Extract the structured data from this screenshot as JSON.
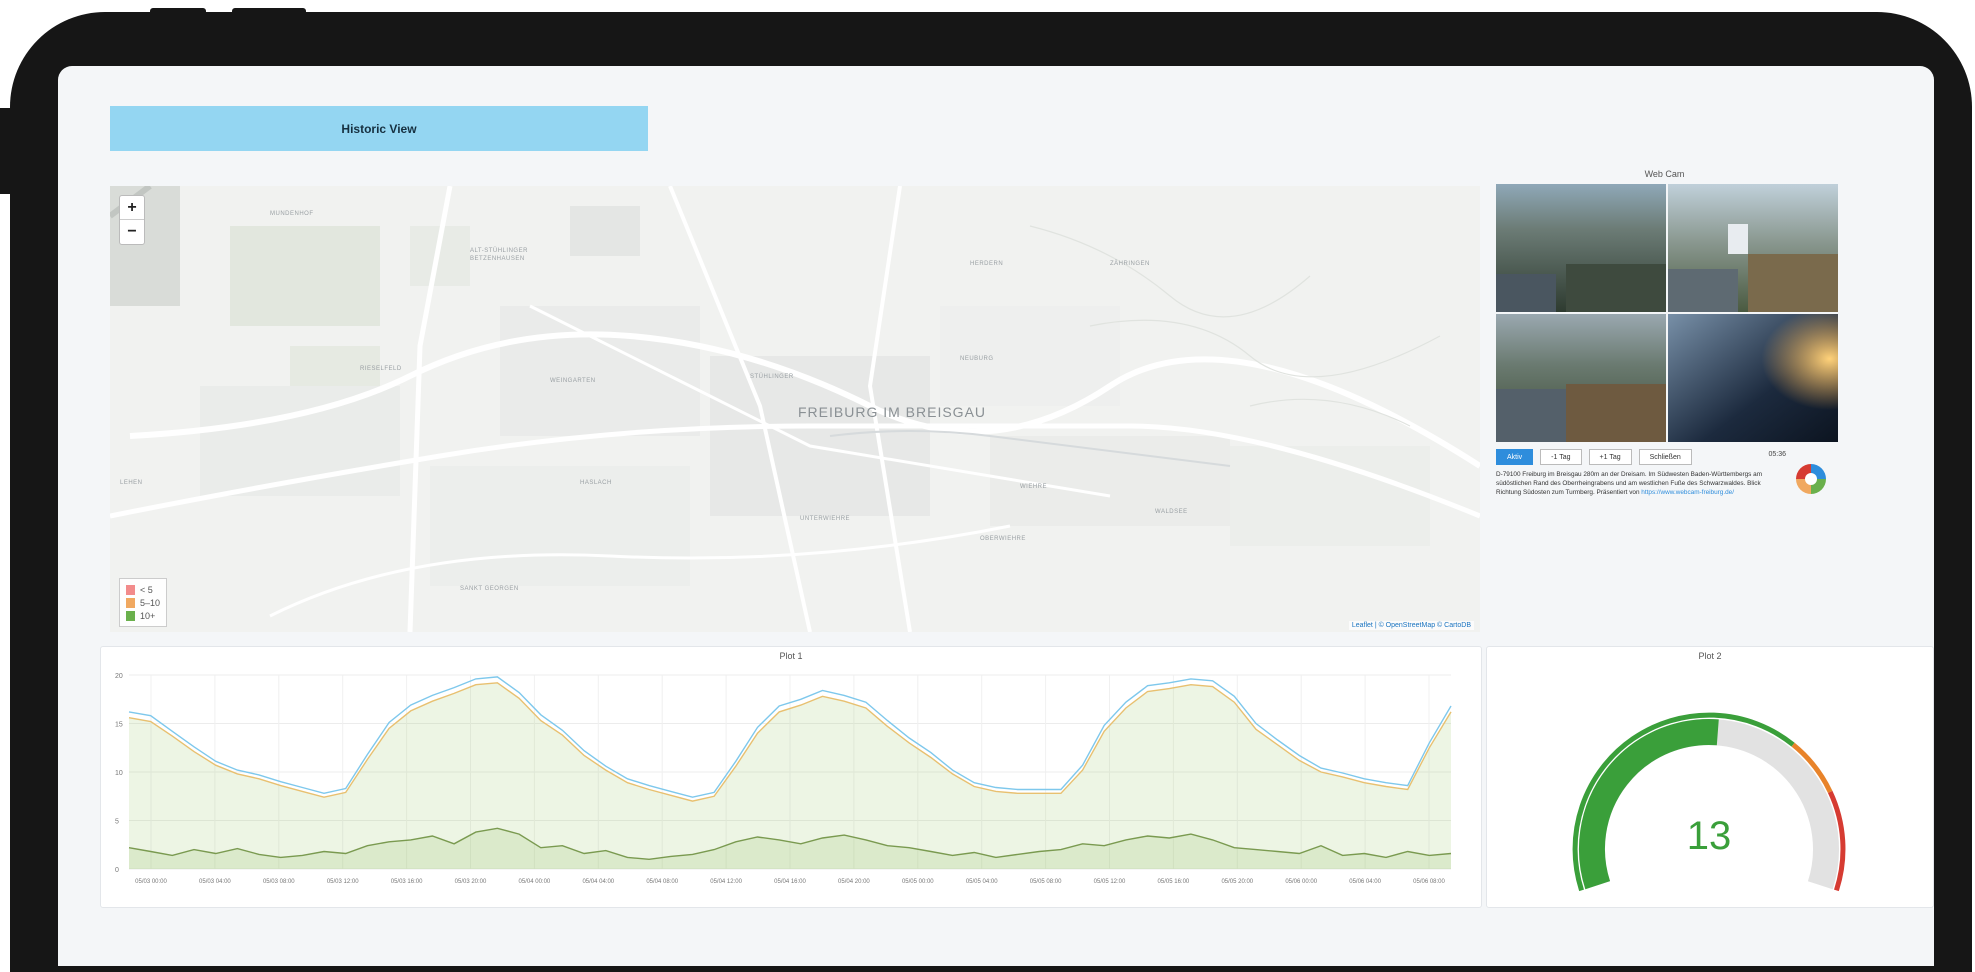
{
  "header": {
    "title": "Historic View"
  },
  "map": {
    "zoom_in": "+",
    "zoom_out": "−",
    "city": "FREIBURG IM BREISGAU",
    "labels": [
      "MUNDENHOF",
      "ALT-STÜHLINGER",
      "BETZENHAUSEN",
      "WEINGARTEN",
      "RIESELFELD",
      "STÜHLINGER",
      "NEUBURG",
      "HERDERN",
      "HASLACH",
      "WALDSEE",
      "WIEHRE",
      "OBERWIEHRE",
      "SANKT GEORGEN",
      "LEHEN",
      "ZÄHRINGEN",
      "UNTERWIEHRE"
    ],
    "legend": [
      {
        "label": "< 5",
        "color": "#f28b8b"
      },
      {
        "label": "5–10",
        "color": "#f0a860"
      },
      {
        "label": "10+",
        "color": "#6ab04c"
      }
    ],
    "attribution": "Leaflet | © OpenStreetMap © CartoDB"
  },
  "webcam": {
    "title": "Web Cam",
    "buttons": {
      "active": "Aktiv",
      "prev": "-1 Tag",
      "next": "+1 Tag",
      "play": "Schließen"
    },
    "time": "05:36",
    "description": "D-79100 Freiburg im Breisgau 280m an der Dreisam. Im Südwesten Baden-Württembergs am südöstlichen Rand des Oberrheingrabens und am westlichen Fuße des Schwarzwaldes. Blick Richtung Südosten zum Turmberg. Präsentiert von",
    "link": "https://www.webcam-freiburg.de/"
  },
  "plot1": {
    "title": "Plot 1"
  },
  "plot2": {
    "title": "Plot 2",
    "value": "13"
  },
  "chart_data": {
    "type": "line",
    "ylim": [
      0,
      20
    ],
    "yticks": [
      0,
      5,
      10,
      15,
      20
    ],
    "x_ticks": [
      "05/03 00:00",
      "05/03 04:00",
      "05/03 08:00",
      "05/03 12:00",
      "05/03 16:00",
      "05/03 20:00",
      "05/04 00:00",
      "05/04 04:00",
      "05/04 08:00",
      "05/04 12:00",
      "05/04 16:00",
      "05/04 20:00",
      "05/05 00:00",
      "05/05 04:00",
      "05/05 08:00",
      "05/05 12:00",
      "05/05 16:00",
      "05/05 20:00",
      "05/06 00:00",
      "05/06 04:00",
      "05/06 08:00"
    ],
    "series": [
      {
        "color": "#7ec8ec",
        "values": [
          16.2,
          15.8,
          14.2,
          12.6,
          11.1,
          10.2,
          9.7,
          9.0,
          8.4,
          7.8,
          8.3,
          11.8,
          15.1,
          16.9,
          17.9,
          18.7,
          19.6,
          19.8,
          18.2,
          15.9,
          14.3,
          12.2,
          10.6,
          9.3,
          8.6,
          8.0,
          7.4,
          7.9,
          11.1,
          14.6,
          16.8,
          17.5,
          18.4,
          17.9,
          17.2,
          15.3,
          13.5,
          12.0,
          10.2,
          8.9,
          8.4,
          8.2,
          8.2,
          8.2,
          10.7,
          14.8,
          17.2,
          18.9,
          19.2,
          19.6,
          19.4,
          17.8,
          15.0,
          13.3,
          11.7,
          10.4,
          9.9,
          9.3,
          8.9,
          8.6,
          13.0,
          16.8
        ]
      },
      {
        "color": "#e8c070",
        "values": [
          15.6,
          15.2,
          13.7,
          12.1,
          10.7,
          9.8,
          9.3,
          8.6,
          8.0,
          7.4,
          7.9,
          11.3,
          14.5,
          16.3,
          17.3,
          18.1,
          19.0,
          19.2,
          17.6,
          15.3,
          13.8,
          11.7,
          10.2,
          8.9,
          8.2,
          7.6,
          7.0,
          7.5,
          10.6,
          14.0,
          16.2,
          16.9,
          17.8,
          17.3,
          16.6,
          14.7,
          13.0,
          11.5,
          9.8,
          8.5,
          8.0,
          7.8,
          7.8,
          7.8,
          10.2,
          14.2,
          16.6,
          18.3,
          18.6,
          19.0,
          18.8,
          17.2,
          14.4,
          12.8,
          11.2,
          10.0,
          9.5,
          8.9,
          8.5,
          8.2,
          12.5,
          16.2
        ]
      },
      {
        "color": "#7a9a50",
        "values": [
          2.2,
          1.8,
          1.4,
          2.0,
          1.6,
          2.1,
          1.5,
          1.2,
          1.4,
          1.8,
          1.6,
          2.4,
          2.8,
          3.0,
          3.4,
          2.6,
          3.8,
          4.2,
          3.6,
          2.2,
          2.4,
          1.6,
          1.9,
          1.2,
          1.0,
          1.3,
          1.5,
          2.0,
          2.8,
          3.3,
          3.0,
          2.6,
          3.2,
          3.5,
          3.0,
          2.4,
          2.2,
          1.8,
          1.4,
          1.7,
          1.2,
          1.5,
          1.8,
          2.0,
          2.6,
          2.4,
          3.0,
          3.4,
          3.2,
          3.6,
          3.0,
          2.2,
          2.0,
          1.8,
          1.6,
          2.4,
          1.4,
          1.6,
          1.2,
          1.8,
          1.4,
          1.6
        ]
      }
    ],
    "gauge": {
      "value": 13,
      "min": 0,
      "max": 25,
      "thresholds": [
        {
          "to": 17,
          "color": "#3a9f3a"
        },
        {
          "to": 20,
          "color": "#e8832a"
        },
        {
          "to": 25,
          "color": "#d63b32"
        }
      ]
    }
  }
}
